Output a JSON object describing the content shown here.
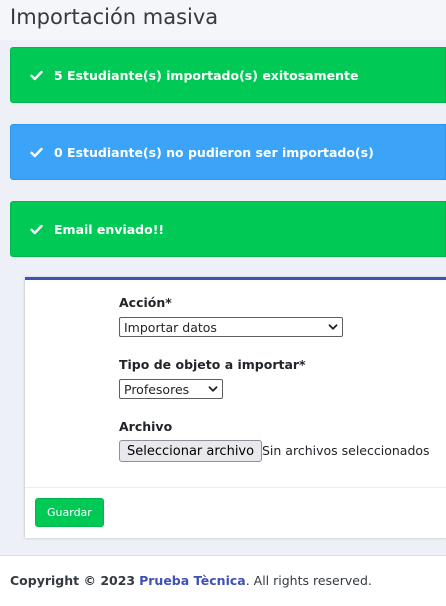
{
  "page": {
    "title": "Importación masiva"
  },
  "alerts": [
    {
      "type": "success",
      "icon": "check-icon",
      "text": "5 Estudiante(s) importado(s) exitosamente"
    },
    {
      "type": "info",
      "icon": "check-icon",
      "text": "0 Estudiante(s) no pudieron ser importado(s)"
    },
    {
      "type": "success",
      "icon": "check-icon",
      "text": "Email enviado!!"
    }
  ],
  "form": {
    "accion": {
      "label": "Acción*",
      "selected": "Importar datos"
    },
    "tipo_objeto": {
      "label": "Tipo de objeto a importar*",
      "selected": "Profesores"
    },
    "archivo": {
      "label": "Archivo",
      "button_label": "Seleccionar archivo",
      "status": "Sin archivos seleccionados"
    },
    "save_label": "Guardar"
  },
  "footer": {
    "copyright_prefix": "Copyright © 2023",
    "company": "Prueba Tècnica",
    "suffix": ". All rights reserved."
  },
  "colors": {
    "success": "#00c956",
    "info": "#3ba4f8",
    "primary": "#3f51b5"
  }
}
